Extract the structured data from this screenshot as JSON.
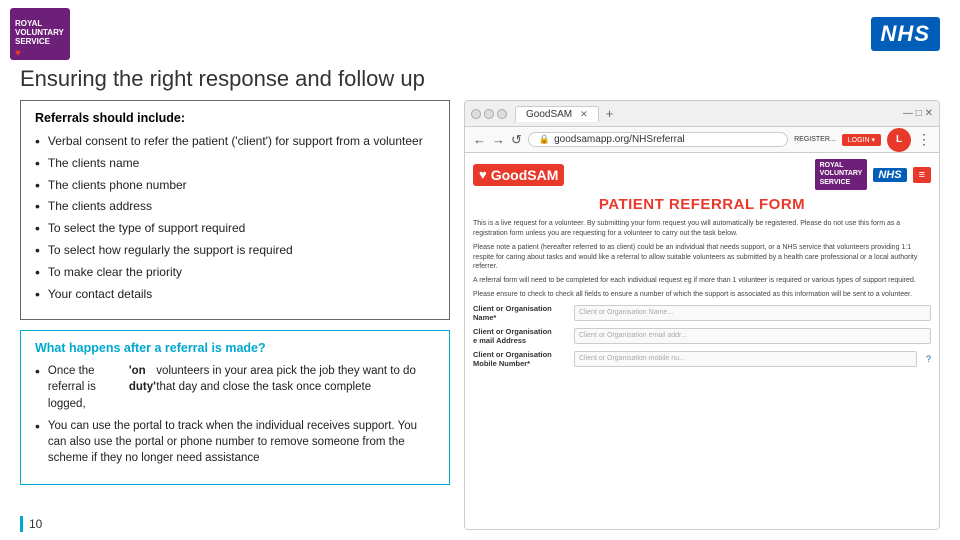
{
  "header": {
    "title": "Ensuring the right response and follow up",
    "nhs_logo": "NHS"
  },
  "referrals_box": {
    "heading": "Referrals should include:",
    "items": [
      "Verbal consent to refer the patient ('client') for support from a volunteer",
      "The clients name",
      "The clients phone number",
      "The clients address",
      "To select the type of support required",
      "To select how regularly the support is required",
      "To make clear the priority",
      "Your contact details"
    ]
  },
  "after_referral_box": {
    "heading": "What happens after a referral is made?",
    "items": [
      {
        "text_before": "Once the referral is logged, ",
        "bold": "'on duty'",
        "text_after": " volunteers in your area pick the job they want to do that day and close the task once complete"
      },
      {
        "text_before": "You can use the portal to track when the individual receives support. You can also use the portal or phone number to remove someone from the scheme if they no longer need assistance",
        "bold": "",
        "text_after": ""
      }
    ]
  },
  "page_number": "10",
  "browser": {
    "tab_label": "GoodSAM",
    "address": "goodsamapp.org/NHSreferral",
    "goodsam_logo": "GoodSAM",
    "patient_referral_title": "PATIENT REFERRAL FORM",
    "small_text_1": "This is a live request for a volunteer. By submitting your form request you will automatically be registered. Please do not use this form as a registration form unless you are requesting for a volunteer to carry out the task below.",
    "small_text_2": "Please note a patient (hereafter referred to as client) could be an individual that needs support, or a NHS service that volunteers providing 1:1 respite for caring about tasks and would like a referral to allow suitable volunteers as submitted by a health care professional or a local authority referrer.",
    "small_text_3": "A referral form will need to be completed for each individual request eg if more than 1 volunteer is required or various types of support required.",
    "small_text_4": "Please ensure to check to check all fields to ensure a number of which the support is associated as this information will be sent to a volunteer.",
    "form_rows": [
      {
        "label": "Client or Organisation Name*",
        "placeholder": "Client or Organisation Name..."
      },
      {
        "label": "Client or Organisation e mail Address",
        "placeholder": "Client or Organisation email addr..."
      },
      {
        "label": "Client or Organisation Mobile Number*",
        "placeholder": "Client or Organisation mobile nu...",
        "has_help": true
      }
    ],
    "register_label": "REGISTER...",
    "login_label": "LOGIN ▾"
  }
}
